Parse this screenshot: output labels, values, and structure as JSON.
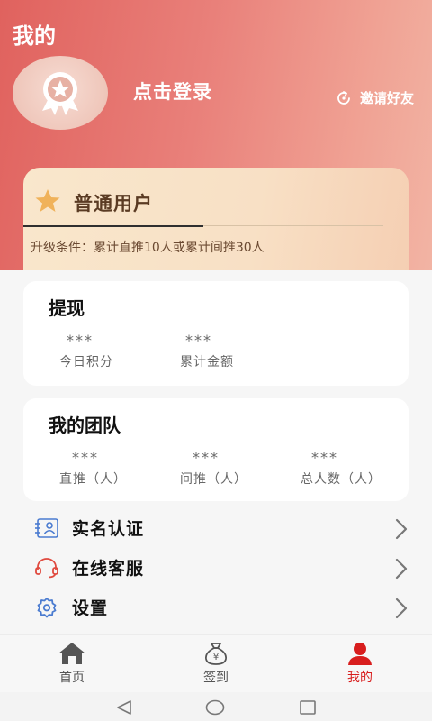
{
  "header": {
    "title": "我的",
    "login_text": "点击登录",
    "invite_text": "邀请好友"
  },
  "member": {
    "level": "普通用户",
    "upgrade_condition": "升级条件：累计直推10人或累计间推30人"
  },
  "withdraw": {
    "title": "提现",
    "stats": [
      {
        "value": "***",
        "label": "今日积分"
      },
      {
        "value": "***",
        "label": "累计金额"
      }
    ]
  },
  "team": {
    "title": "我的团队",
    "stats": [
      {
        "value": "***",
        "label": "直推（人）"
      },
      {
        "value": "***",
        "label": "间推（人）"
      },
      {
        "value": "***",
        "label": "总人数（人）"
      }
    ]
  },
  "menu": [
    {
      "label": "实名认证",
      "icon": "id-card-icon"
    },
    {
      "label": "在线客服",
      "icon": "headset-icon"
    },
    {
      "label": "设置",
      "icon": "gear-icon"
    }
  ],
  "tabs": [
    {
      "label": "首页",
      "icon": "home-icon"
    },
    {
      "label": "签到",
      "icon": "money-bag-icon"
    },
    {
      "label": "我的",
      "icon": "user-icon",
      "active": true
    }
  ],
  "colors": {
    "header_start": "#e0625e",
    "header_end": "#f2b4a4",
    "active_tab": "#d81e1e",
    "menu_icon": "#4a7bd0",
    "headset_icon": "#e04a3f"
  }
}
